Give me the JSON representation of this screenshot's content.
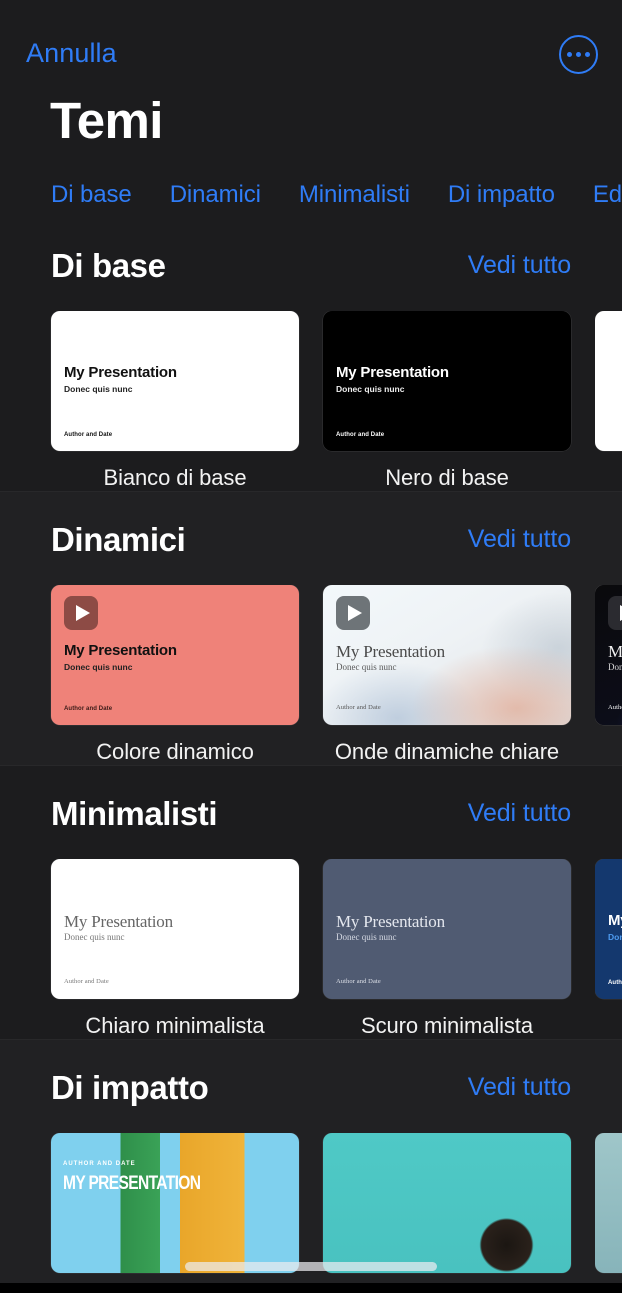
{
  "navbar": {
    "cancel_label": "Annulla",
    "more_icon": "ellipsis-circle-icon"
  },
  "page_title": "Temi",
  "tabs": [
    {
      "label": "Di base"
    },
    {
      "label": "Dinamici"
    },
    {
      "label": "Minimalisti"
    },
    {
      "label": "Di impatto"
    },
    {
      "label": "Editor"
    }
  ],
  "see_all_label": "Vedi tutto",
  "slide_text": {
    "title": "My Presentation",
    "subtitle": "Donec quis nunc",
    "footer": "Author and Date",
    "photo_kicker": "AUTHOR AND DATE",
    "photo_title": "MY PRESENTATION"
  },
  "colors": {
    "accent": "#2f7cf6",
    "background": "#1c1c1e",
    "section_alt": "#212123",
    "text": "#ffffff",
    "coral": "#ef8279",
    "slate": "#505b72",
    "navy": "#14386e"
  },
  "sections": [
    {
      "title": "Di base",
      "cards": [
        {
          "label": "Bianco di base"
        },
        {
          "label": "Nero di base"
        },
        {
          "label": ""
        }
      ]
    },
    {
      "title": "Dinamici",
      "cards": [
        {
          "label": "Colore dinamico"
        },
        {
          "label": "Onde dinamiche chiare"
        },
        {
          "label": ""
        }
      ]
    },
    {
      "title": "Minimalisti",
      "cards": [
        {
          "label": "Chiaro minimalista"
        },
        {
          "label": "Scuro minimalista"
        },
        {
          "label": ""
        }
      ]
    },
    {
      "title": "Di impatto",
      "cards": [
        {
          "label": ""
        },
        {
          "label": ""
        },
        {
          "label": ""
        }
      ]
    }
  ]
}
